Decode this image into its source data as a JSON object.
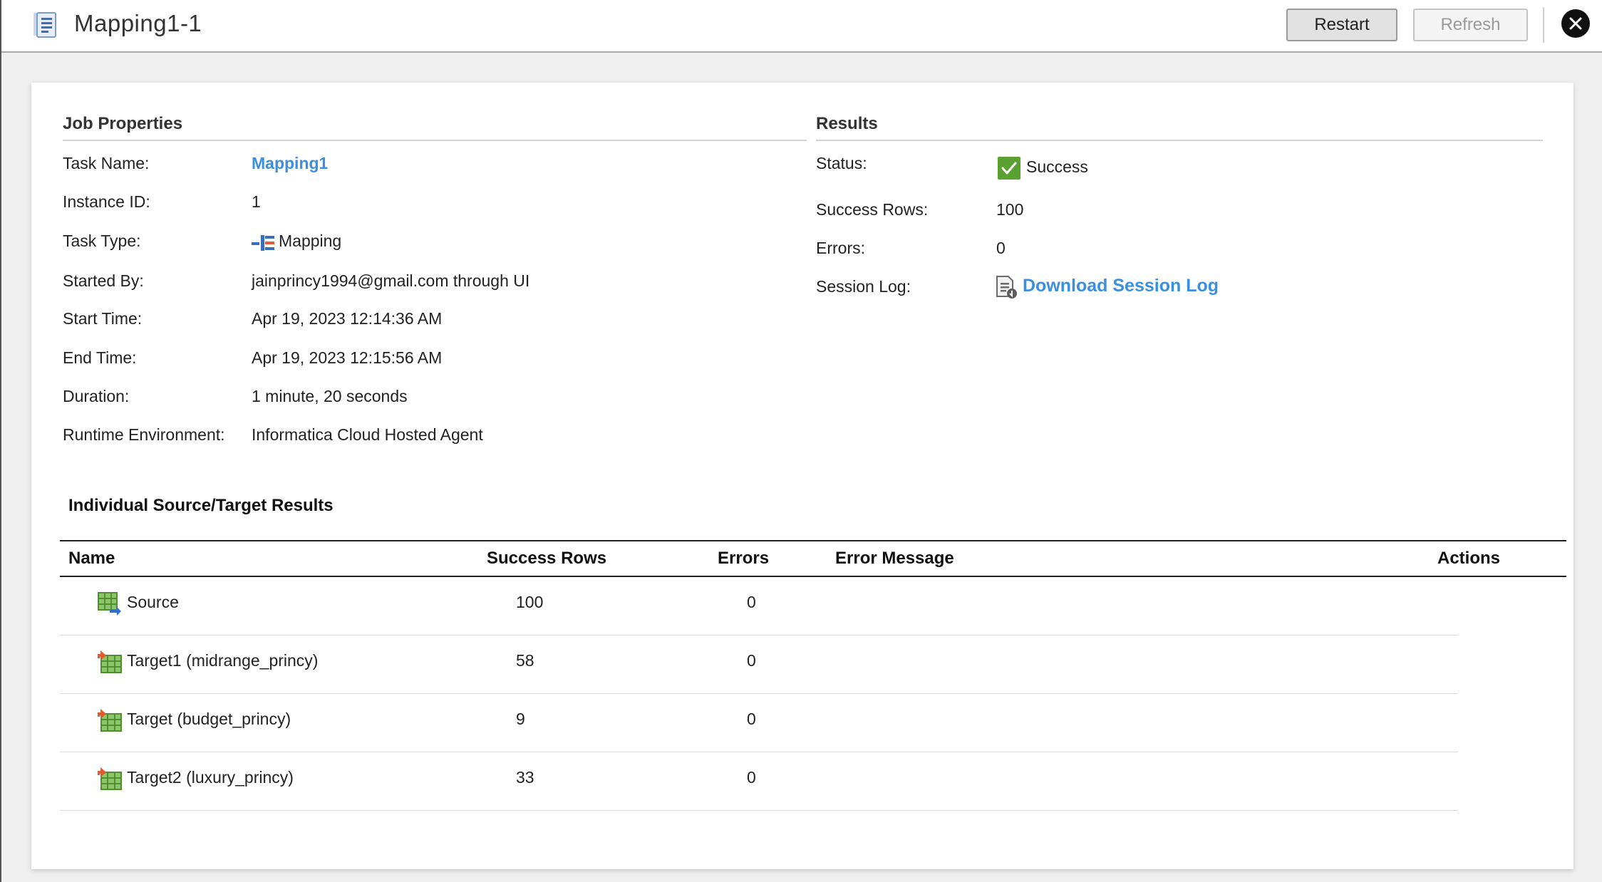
{
  "header": {
    "title": "Mapping1-1",
    "title_icon": "document-list-icon",
    "restart_label": "Restart",
    "refresh_label": "Refresh",
    "close_icon": "close-icon"
  },
  "job_properties": {
    "title": "Job Properties",
    "rows": [
      {
        "label": "Task Name:",
        "value": "Mapping1"
      },
      {
        "label": "Instance ID:",
        "value": "1"
      },
      {
        "label": "Task Type:",
        "value": "Mapping"
      },
      {
        "label": "Started By:",
        "value": "jainprincy1994@gmail.com through UI"
      },
      {
        "label": "Start Time:",
        "value": "Apr 19, 2023 12:14:36 AM"
      },
      {
        "label": "End Time:",
        "value": "Apr 19, 2023 12:15:56 AM"
      },
      {
        "label": "Duration:",
        "value": "1 minute, 20 seconds"
      },
      {
        "label": "Runtime Environment:",
        "value": "Informatica Cloud Hosted Agent"
      }
    ]
  },
  "results": {
    "title": "Results",
    "rows": [
      {
        "label": "Status:",
        "value": "Success"
      },
      {
        "label": "Success Rows:",
        "value": "100"
      },
      {
        "label": "Errors:",
        "value": "0"
      },
      {
        "label": "Session Log:",
        "value": "Download Session Log"
      }
    ],
    "status_color": "#5aa132",
    "link_color": "#3b8fe0"
  },
  "source_target": {
    "title": "Individual Source/Target Results",
    "columns": [
      "Name",
      "Success Rows",
      "Errors",
      "Error Message",
      "Actions"
    ],
    "rows": [
      {
        "name": "Source",
        "success_rows": "100",
        "errors": "0",
        "error_message": "",
        "icon": "source-table-icon"
      },
      {
        "name": "Target1 (midrange_princy)",
        "success_rows": "58",
        "errors": "0",
        "error_message": "",
        "icon": "target-table-icon"
      },
      {
        "name": "Target (budget_princy)",
        "success_rows": "9",
        "errors": "0",
        "error_message": "",
        "icon": "target-table-icon"
      },
      {
        "name": "Target2 (luxury_princy)",
        "success_rows": "33",
        "errors": "0",
        "error_message": "",
        "icon": "target-table-icon"
      }
    ]
  }
}
